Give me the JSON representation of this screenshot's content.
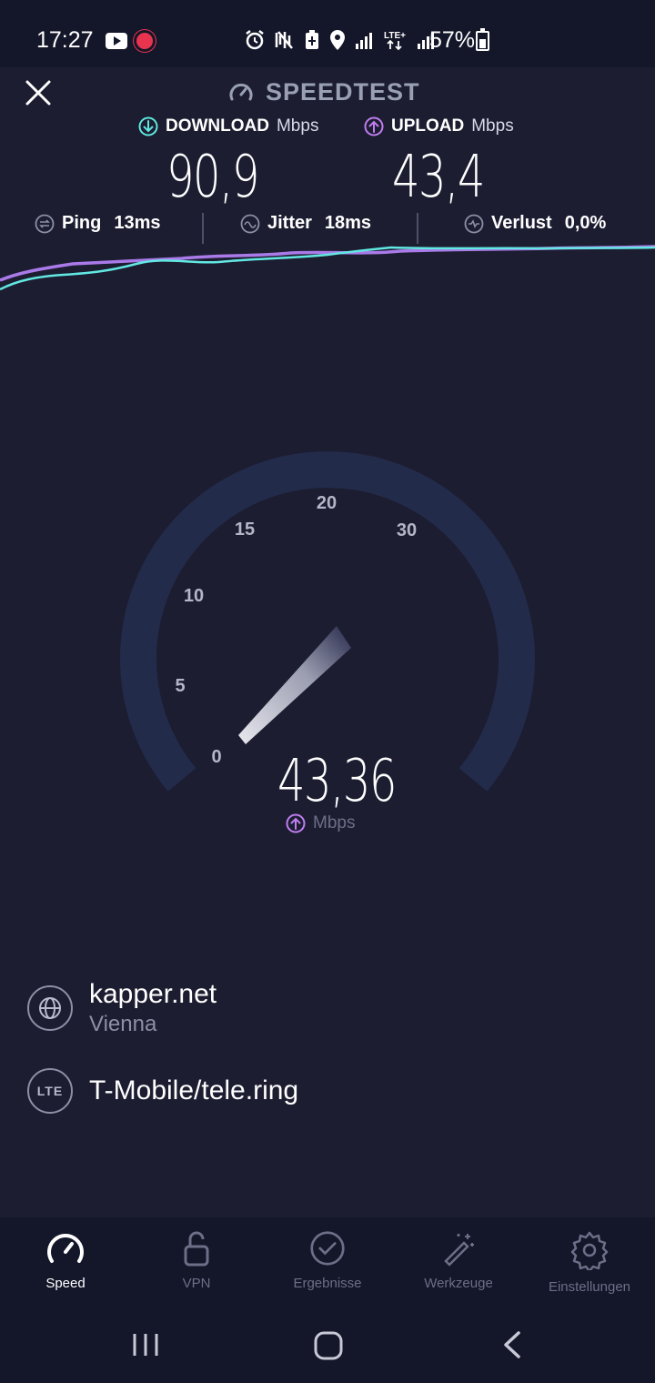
{
  "status_bar": {
    "time": "17:27",
    "battery_percent": "57%",
    "icons": [
      "youtube-icon",
      "recording-icon",
      "alarm-icon",
      "vibrate-icon",
      "battery-saver-icon",
      "location-icon",
      "signal-icon",
      "lte-plus-icon",
      "signal-icon"
    ]
  },
  "header": {
    "title": "SPEEDTEST",
    "close_icon": "close-icon"
  },
  "download": {
    "label": "DOWNLOAD",
    "unit": "Mbps",
    "value": "90,9",
    "color": "#5fe6df"
  },
  "upload": {
    "label": "UPLOAD",
    "unit": "Mbps",
    "value": "43,4",
    "color": "#c07ef0"
  },
  "stats": {
    "ping": {
      "label": "Ping",
      "value": "13ms"
    },
    "jitter": {
      "label": "Jitter",
      "value": "18ms"
    },
    "loss": {
      "label": "Verlust",
      "value": "0,0%"
    }
  },
  "gauge": {
    "ticks": [
      "0",
      "5",
      "10",
      "15",
      "20",
      "30"
    ],
    "current_value": "43,36",
    "unit": "Mbps",
    "level": 1.0
  },
  "server": {
    "name": "kapper.net",
    "location": "Vienna"
  },
  "provider": {
    "badge": "LTE",
    "name": "T-Mobile/tele.ring"
  },
  "nav": {
    "items": [
      {
        "label": "Speed",
        "icon": "speedometer-icon",
        "active": true
      },
      {
        "label": "VPN",
        "icon": "lock-icon",
        "active": false
      },
      {
        "label": "Ergebnisse",
        "icon": "check-circle-icon",
        "active": false
      },
      {
        "label": "Werkzeuge",
        "icon": "magic-wand-icon",
        "active": false
      },
      {
        "label": "Einstellungen",
        "icon": "gear-icon",
        "active": false
      }
    ]
  },
  "system_nav": {
    "recents": "recents-icon",
    "home": "home-icon",
    "back": "back-icon"
  }
}
